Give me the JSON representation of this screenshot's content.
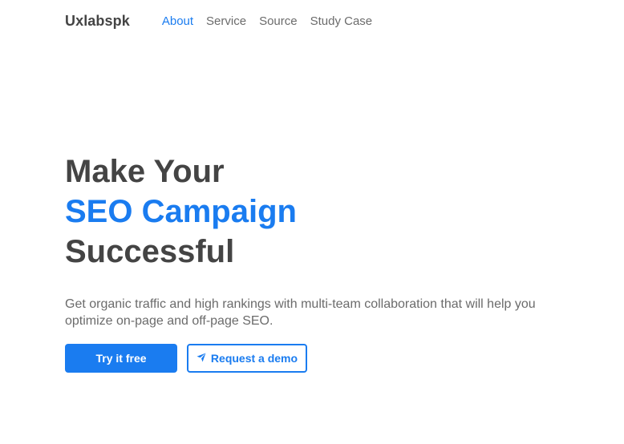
{
  "nav": {
    "brand": "Uxlabspk",
    "links": [
      {
        "label": "About",
        "active": true
      },
      {
        "label": "Service",
        "active": false
      },
      {
        "label": "Source",
        "active": false
      },
      {
        "label": "Study Case",
        "active": false
      }
    ]
  },
  "hero": {
    "headline_line1": "Make Your",
    "headline_line2": "SEO Campaign",
    "headline_line3": "Successful",
    "description": "Get organic traffic and high rankings with multi-team collaboration that will help you optimize on-page and off-page SEO.",
    "primary_button": "Try it free",
    "secondary_button": "Request a demo",
    "secondary_icon": "paper-plane-icon"
  },
  "colors": {
    "accent": "#1a7cf0",
    "heading": "#444444",
    "body_text": "#6b6b6b"
  }
}
